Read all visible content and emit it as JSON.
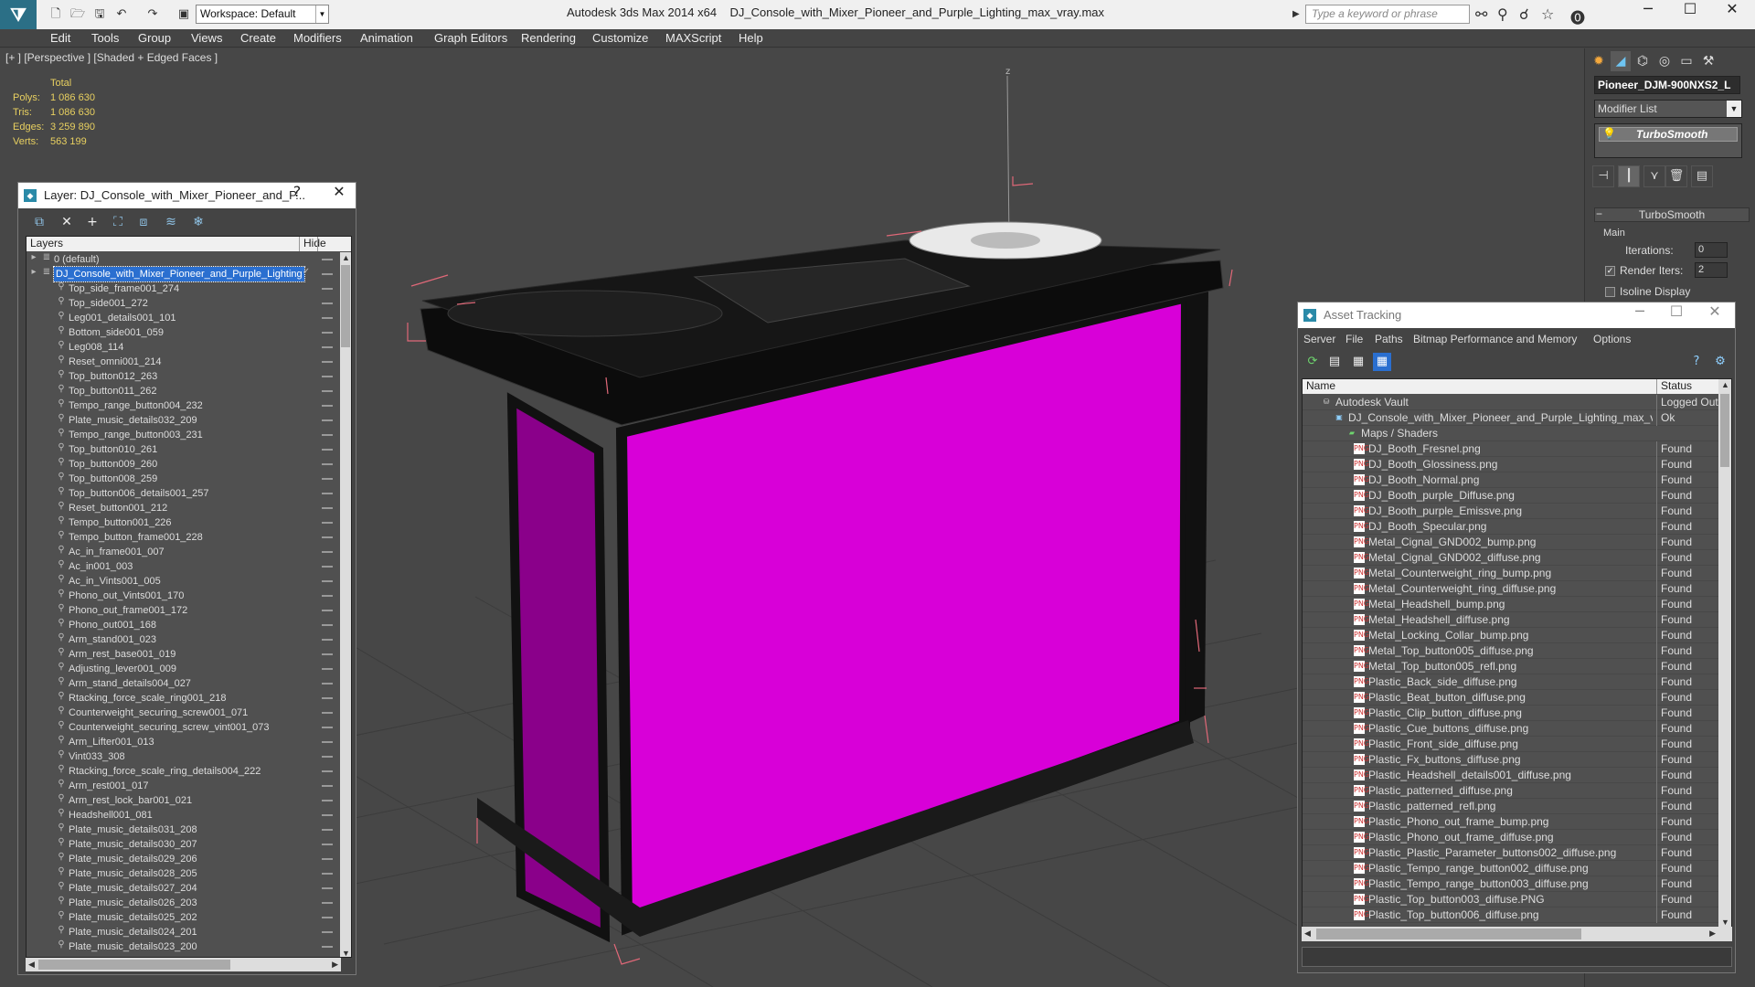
{
  "app": {
    "title": "Autodesk 3ds Max  2014 x64",
    "file": "DJ_Console_with_Mixer_Pioneer_and_Purple_Lighting_max_vray.max",
    "workspace": "Workspace: Default",
    "search_placeholder": "Type a keyword or phrase"
  },
  "menubar": [
    "Edit",
    "Tools",
    "Group",
    "Views",
    "Create",
    "Modifiers",
    "Animation",
    "Graph Editors",
    "Rendering",
    "Customize",
    "MAXScript",
    "Help"
  ],
  "viewport": {
    "label": "[+ ] [Perspective ] [Shaded + Edged Faces ]",
    "stats_header": "Total",
    "stats": [
      {
        "k": "Polys:",
        "v": "1 086 630"
      },
      {
        "k": "Tris:",
        "v": "1 086 630"
      },
      {
        "k": "Edges:",
        "v": "3 259 890"
      },
      {
        "k": "Verts:",
        "v": "563 199"
      }
    ],
    "axis_label": "z",
    "colors": {
      "panel": "#d800d8",
      "panel_dark": "#8a008a",
      "frame": "#111111",
      "bbox": "#e06878",
      "grid": "#3e3e3e"
    }
  },
  "command_panel": {
    "object_name": "Pioneer_DJM-900NXS2_L",
    "modifier_list": "Modifier List",
    "stack_item": "TurboSmooth",
    "rollout_title": "TurboSmooth",
    "group_main": "Main",
    "iterations_label": "Iterations:",
    "iterations_value": "0",
    "render_iters_label": "Render Iters:",
    "render_iters_value": "2",
    "render_iters_checked": true,
    "isoline_label": "Isoline Display"
  },
  "layer_dialog": {
    "title": "Layer: DJ_Console_with_Mixer_Pioneer_and_P...",
    "help": "?",
    "col_layers": "Layers",
    "col_hide": "Hide",
    "layers": [
      {
        "name": "0 (default)",
        "level": 0,
        "type": "layer"
      },
      {
        "name": "DJ_Console_with_Mixer_Pioneer_and_Purple_Lighting",
        "level": 0,
        "type": "layer",
        "selected": true
      },
      {
        "name": "Top_side_frame001_274",
        "level": 1
      },
      {
        "name": "Top_side001_272",
        "level": 1
      },
      {
        "name": "Leg001_details001_101",
        "level": 1
      },
      {
        "name": "Bottom_side001_059",
        "level": 1
      },
      {
        "name": "Leg008_114",
        "level": 1
      },
      {
        "name": "Reset_omni001_214",
        "level": 1
      },
      {
        "name": "Top_button012_263",
        "level": 1
      },
      {
        "name": "Top_button011_262",
        "level": 1
      },
      {
        "name": "Tempo_range_button004_232",
        "level": 1
      },
      {
        "name": "Plate_music_details032_209",
        "level": 1
      },
      {
        "name": "Tempo_range_button003_231",
        "level": 1
      },
      {
        "name": "Top_button010_261",
        "level": 1
      },
      {
        "name": "Top_button009_260",
        "level": 1
      },
      {
        "name": "Top_button008_259",
        "level": 1
      },
      {
        "name": "Top_button006_details001_257",
        "level": 1
      },
      {
        "name": "Reset_button001_212",
        "level": 1
      },
      {
        "name": "Tempo_button001_226",
        "level": 1
      },
      {
        "name": "Tempo_button_frame001_228",
        "level": 1
      },
      {
        "name": "Ac_in_frame001_007",
        "level": 1
      },
      {
        "name": "Ac_in001_003",
        "level": 1
      },
      {
        "name": "Ac_in_Vints001_005",
        "level": 1
      },
      {
        "name": "Phono_out_Vints001_170",
        "level": 1
      },
      {
        "name": "Phono_out_frame001_172",
        "level": 1
      },
      {
        "name": "Phono_out001_168",
        "level": 1
      },
      {
        "name": "Arm_stand001_023",
        "level": 1
      },
      {
        "name": "Arm_rest_base001_019",
        "level": 1
      },
      {
        "name": "Adjusting_lever001_009",
        "level": 1
      },
      {
        "name": "Arm_stand_details004_027",
        "level": 1
      },
      {
        "name": "Rtacking_force_scale_ring001_218",
        "level": 1
      },
      {
        "name": "Counterweight_securing_screw001_071",
        "level": 1
      },
      {
        "name": "Counterweight_securing_screw_vint001_073",
        "level": 1
      },
      {
        "name": "Arm_Lifter001_013",
        "level": 1
      },
      {
        "name": "Vint033_308",
        "level": 1
      },
      {
        "name": "Rtacking_force_scale_ring_details004_222",
        "level": 1
      },
      {
        "name": "Arm_rest001_017",
        "level": 1
      },
      {
        "name": "Arm_rest_lock_bar001_021",
        "level": 1
      },
      {
        "name": "Headshell001_081",
        "level": 1
      },
      {
        "name": "Plate_music_details031_208",
        "level": 1
      },
      {
        "name": "Plate_music_details030_207",
        "level": 1
      },
      {
        "name": "Plate_music_details029_206",
        "level": 1
      },
      {
        "name": "Plate_music_details028_205",
        "level": 1
      },
      {
        "name": "Plate_music_details027_204",
        "level": 1
      },
      {
        "name": "Plate_music_details026_203",
        "level": 1
      },
      {
        "name": "Plate_music_details025_202",
        "level": 1
      },
      {
        "name": "Plate_music_details024_201",
        "level": 1
      },
      {
        "name": "Plate_music_details023_200",
        "level": 1
      }
    ]
  },
  "asset_dialog": {
    "title": "Asset Tracking",
    "menu": [
      "Server",
      "File",
      "Paths",
      "Bitmap Performance and Memory",
      "Options"
    ],
    "col_name": "Name",
    "col_status": "Status",
    "rows": [
      {
        "name": "Autodesk Vault",
        "status": "Logged Out",
        "type": "vault",
        "level": 0
      },
      {
        "name": "DJ_Console_with_Mixer_Pioneer_and_Purple_Lighting_max_vray.max",
        "status": "Ok",
        "type": "max",
        "level": 1
      },
      {
        "name": "Maps / Shaders",
        "status": "",
        "type": "folder",
        "level": 2
      },
      {
        "name": "DJ_Booth_Fresnel.png",
        "status": "Found",
        "type": "png",
        "level": 3
      },
      {
        "name": "DJ_Booth_Glossiness.png",
        "status": "Found",
        "type": "png",
        "level": 3
      },
      {
        "name": "DJ_Booth_Normal.png",
        "status": "Found",
        "type": "png",
        "level": 3
      },
      {
        "name": "DJ_Booth_purple_Diffuse.png",
        "status": "Found",
        "type": "png",
        "level": 3
      },
      {
        "name": "DJ_Booth_purple_Emissve.png",
        "status": "Found",
        "type": "png",
        "level": 3
      },
      {
        "name": "DJ_Booth_Specular.png",
        "status": "Found",
        "type": "png",
        "level": 3
      },
      {
        "name": "Metal_Cignal_GND002_bump.png",
        "status": "Found",
        "type": "png",
        "level": 3
      },
      {
        "name": "Metal_Cignal_GND002_diffuse.png",
        "status": "Found",
        "type": "png",
        "level": 3
      },
      {
        "name": "Metal_Counterweight_ring_bump.png",
        "status": "Found",
        "type": "png",
        "level": 3
      },
      {
        "name": "Metal_Counterweight_ring_diffuse.png",
        "status": "Found",
        "type": "png",
        "level": 3
      },
      {
        "name": "Metal_Headshell_bump.png",
        "status": "Found",
        "type": "png",
        "level": 3
      },
      {
        "name": "Metal_Headshell_diffuse.png",
        "status": "Found",
        "type": "png",
        "level": 3
      },
      {
        "name": "Metal_Locking_Collar_bump.png",
        "status": "Found",
        "type": "png",
        "level": 3
      },
      {
        "name": "Metal_Top_button005_diffuse.png",
        "status": "Found",
        "type": "png",
        "level": 3
      },
      {
        "name": "Metal_Top_button005_refl.png",
        "status": "Found",
        "type": "png",
        "level": 3
      },
      {
        "name": "Plastic_Back_side_diffuse.png",
        "status": "Found",
        "type": "png",
        "level": 3
      },
      {
        "name": "Plastic_Beat_button_diffuse.png",
        "status": "Found",
        "type": "png",
        "level": 3
      },
      {
        "name": "Plastic_Clip_button_diffuse.png",
        "status": "Found",
        "type": "png",
        "level": 3
      },
      {
        "name": "Plastic_Cue_buttons_diffuse.png",
        "status": "Found",
        "type": "png",
        "level": 3
      },
      {
        "name": "Plastic_Front_side_diffuse.png",
        "status": "Found",
        "type": "png",
        "level": 3
      },
      {
        "name": "Plastic_Fx_buttons_diffuse.png",
        "status": "Found",
        "type": "png",
        "level": 3
      },
      {
        "name": "Plastic_Headshell_details001_diffuse.png",
        "status": "Found",
        "type": "png",
        "level": 3
      },
      {
        "name": "Plastic_patterned_diffuse.png",
        "status": "Found",
        "type": "png",
        "level": 3
      },
      {
        "name": "Plastic_patterned_refl.png",
        "status": "Found",
        "type": "png",
        "level": 3
      },
      {
        "name": "Plastic_Phono_out_frame_bump.png",
        "status": "Found",
        "type": "png",
        "level": 3
      },
      {
        "name": "Plastic_Phono_out_frame_diffuse.png",
        "status": "Found",
        "type": "png",
        "level": 3
      },
      {
        "name": "Plastic_Plastic_Parameter_buttons002_diffuse.png",
        "status": "Found",
        "type": "png",
        "level": 3
      },
      {
        "name": "Plastic_Tempo_range_button002_diffuse.png",
        "status": "Found",
        "type": "png",
        "level": 3
      },
      {
        "name": "Plastic_Tempo_range_button003_diffuse.png",
        "status": "Found",
        "type": "png",
        "level": 3
      },
      {
        "name": "Plastic_Top_button003_diffuse.PNG",
        "status": "Found",
        "type": "png",
        "level": 3
      },
      {
        "name": "Plastic_Top_button006_diffuse.png",
        "status": "Found",
        "type": "png",
        "level": 3
      }
    ]
  }
}
